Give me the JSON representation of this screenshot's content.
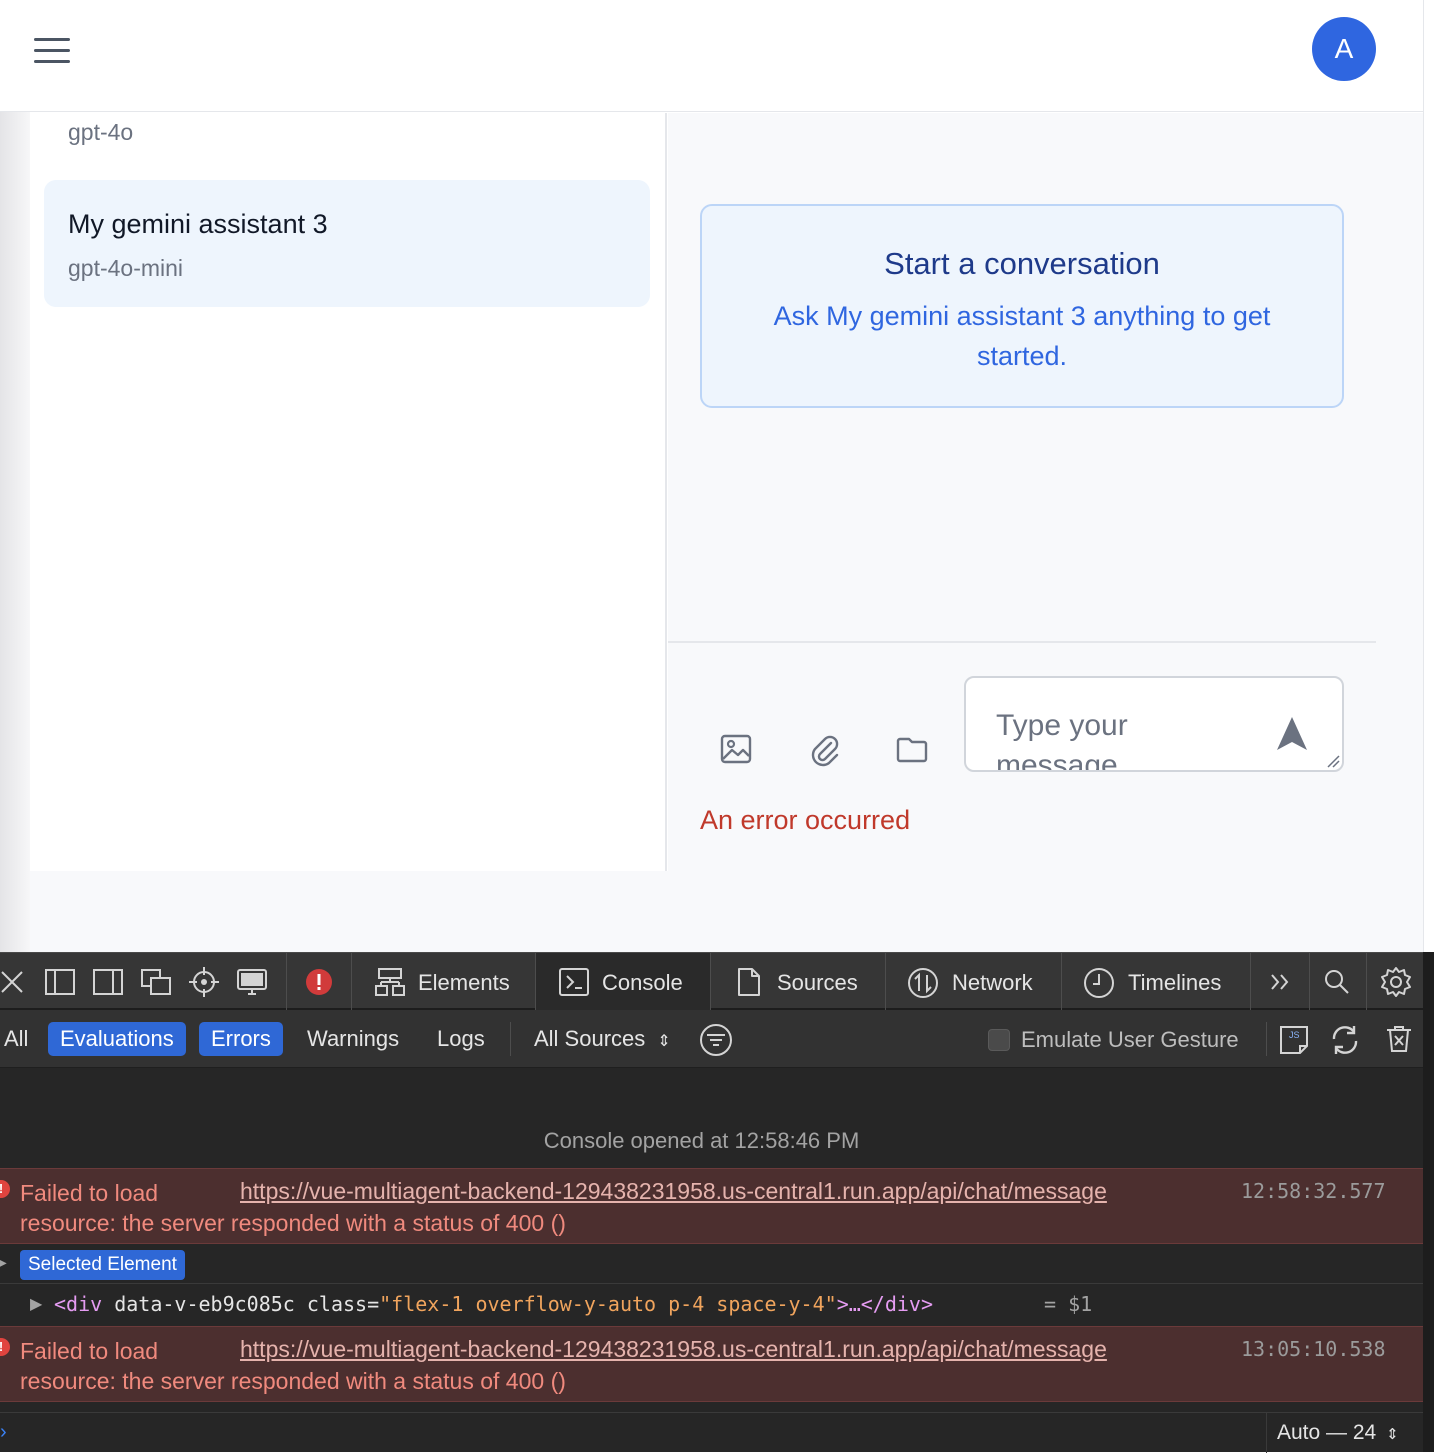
{
  "header": {
    "avatar_initial": "A"
  },
  "sidebar": {
    "previous_model": "gpt-4o",
    "assistants": [
      {
        "name": "My gemini assistant 3",
        "model": "gpt-4o-mini",
        "selected": true
      }
    ]
  },
  "chat": {
    "empty_title": "Start a conversation",
    "empty_subtitle": "Ask My gemini assistant 3 anything to get started.",
    "input_placeholder": "Type your message...",
    "error_text": "An error occurred",
    "tools": [
      "image-icon",
      "paperclip-icon",
      "folder-icon"
    ]
  },
  "devtools": {
    "tabs": [
      {
        "label": "Elements",
        "icon": "elements-icon"
      },
      {
        "label": "Console",
        "icon": "console-icon",
        "active": true
      },
      {
        "label": "Sources",
        "icon": "sources-icon"
      },
      {
        "label": "Network",
        "icon": "network-icon"
      },
      {
        "label": "Timelines",
        "icon": "timelines-icon"
      }
    ],
    "filters": [
      {
        "label": "All",
        "active": false
      },
      {
        "label": "Evaluations",
        "active": true
      },
      {
        "label": "Errors",
        "active": true
      },
      {
        "label": "Warnings",
        "active": false
      },
      {
        "label": "Logs",
        "active": false
      }
    ],
    "sources_select": "All Sources",
    "emulate_label": "Emulate User Gesture",
    "console": {
      "opened_text": "Console opened at 12:58:46 PM",
      "entries": [
        {
          "message": "Failed to load resource: the server responded with a status of 400 ()",
          "url": "https://vue-multiagent-backend-129438231958.us-central1.run.app/api/chat/message",
          "time": "12:58:32.577"
        },
        {
          "message": "Failed to load resource: the server responded with a status of 400 ()",
          "url": "https://vue-multiagent-backend-129438231958.us-central1.run.app/api/chat/message",
          "time": "13:05:10.538"
        }
      ],
      "selected_badge": "Selected Element",
      "node": {
        "tag_open": "<div",
        "attr1": " data-v-eb9c085c",
        "attr2": " class=",
        "class_value": "\"flex-1 overflow-y-auto p-4 space-y-4\"",
        "tag_close": ">…</div>",
        "ref": "= $1"
      }
    },
    "zoom_select": "Auto — 24"
  },
  "colors": {
    "accent": "#2f66e0",
    "error": "#c0392b",
    "devtools_bg": "#262626",
    "devtools_error_row": "#4c2f2f"
  }
}
